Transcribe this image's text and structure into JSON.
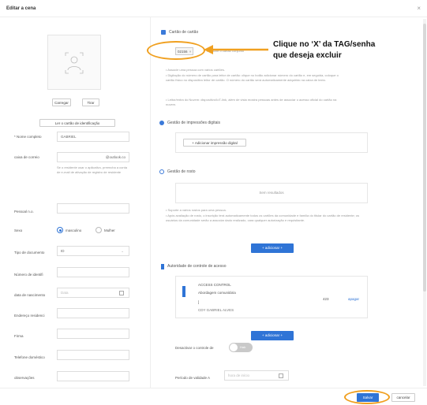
{
  "dialog": {
    "title": "Editar a cena",
    "close_glyph": "×"
  },
  "left": {
    "upload_label": "Carregar",
    "take_label": "Tirar",
    "read_card_label": "Ler o cartão de identificação",
    "fields": [
      {
        "label": "* Nome completo",
        "value": "GABRIEL"
      },
      {
        "label": "caixa de correio",
        "value": "@outlook.co"
      },
      {
        "label": "Pessoal n.o.",
        "value": ""
      },
      {
        "label": "Tipo de documento",
        "value": "ID"
      },
      {
        "label": "Número de identifi",
        "value": ""
      },
      {
        "label": "data de nascimento",
        "value": "Data"
      },
      {
        "label": "Endereço residenci",
        "value": ""
      },
      {
        "label": "Firma",
        "value": ""
      },
      {
        "label": "Telefone doméstico",
        "value": ""
      },
      {
        "label": "observações",
        "value": ""
      }
    ],
    "email_help": "Se o residente usar o aplicativo, preencha a conta de e-mail de ativação de registro de residente",
    "gender": {
      "label": "Sexo",
      "option_male": "masculino",
      "option_female": "Mulher"
    }
  },
  "right": {
    "card": {
      "title": "Cartão de cartão",
      "tag": "02156",
      "tag_close": "×",
      "add_hint": "Adicione o cartão conjunto",
      "notes": [
        "• Associe uma pessoa com vários cartões.",
        "• Digitação do número de cartão para leitor de cartão: clique no botão adicionar número do cartão e, em seguida, coloque o cartão físico no dispositivo leitor de cartão. O número do cartão será automaticamente adquirido na caixa de texto.",
        "• Leitor/entra do Nuvem: dispositivo/IoT-link, além de vista mostra pessoas antes de associar o acesso oficial do cartão na nuvem."
      ]
    },
    "fingerprint": {
      "title": "Gestão de impressões digitais",
      "add_label": "+ Adicionar impressão digital"
    },
    "face": {
      "title": "Gestão de rosto",
      "empty": "Sem resultados",
      "notes": [
        "• Suporte a vários rostos para uma pessoa.",
        "• Após avaliação de rosto, o inscrição terá automaticamente todos os cartões da comunidade e família do titular do cartão de residente; os usuários da comunidade serão a associar dado realizado, cara qualquer autorização e requisitante."
      ],
      "add_label": "+ adicionar +"
    },
    "access": {
      "title": "Autoridade de controle de acesso",
      "card_name": "ACCESS CONTROL",
      "card_sub": "Abordagem comunitária",
      "card_count": "423",
      "card_bracket": "]",
      "card_line": "CDY GABRIEL ALVES",
      "remove_label": "apagar",
      "add_label": "+ adicionar +"
    },
    "toggle_label": "Desactivar o controle de",
    "toggle_text": "Hab",
    "validity_label": "Período de validade A",
    "validity_placeholder": "hora de início"
  },
  "footer": {
    "save_label": "Salvar",
    "cancel_label": "cancelar"
  },
  "annotation": {
    "line1": "Clique no ‘X’ da TAG/senha",
    "line2": "que deseja excluir",
    "color": "#f0a020"
  },
  "colors": {
    "accent": "#2f74d6",
    "highlight": "#f0a020"
  }
}
